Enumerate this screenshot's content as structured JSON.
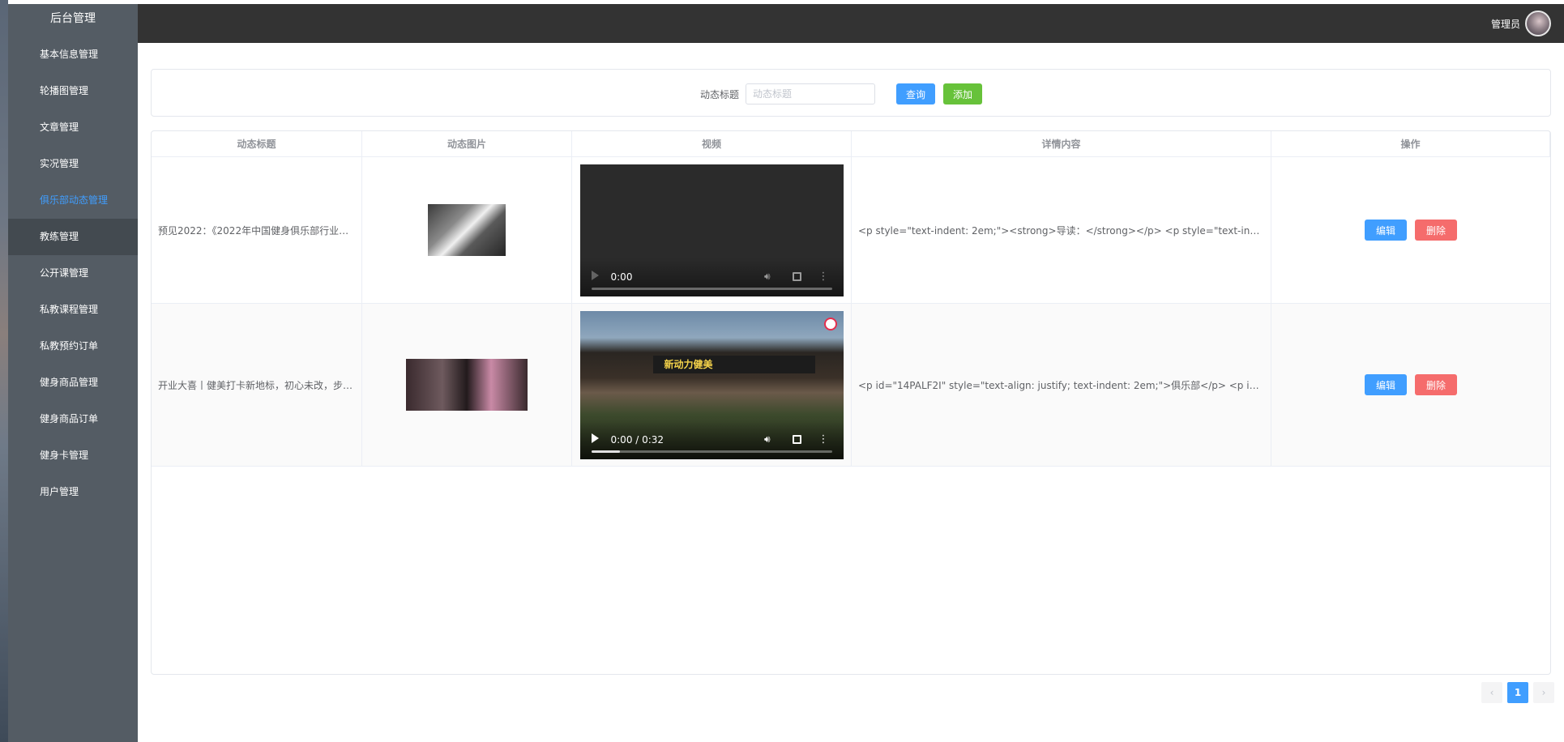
{
  "sidebar": {
    "title": "后台管理",
    "items": [
      {
        "label": "基本信息管理"
      },
      {
        "label": "轮播图管理"
      },
      {
        "label": "文章管理"
      },
      {
        "label": "实况管理"
      },
      {
        "label": "俱乐部动态管理"
      },
      {
        "label": "教练管理"
      },
      {
        "label": "公开课管理"
      },
      {
        "label": "私教课程管理"
      },
      {
        "label": "私教预约订单"
      },
      {
        "label": "健身商品管理"
      },
      {
        "label": "健身商品订单"
      },
      {
        "label": "健身卡管理"
      },
      {
        "label": "用户管理"
      }
    ],
    "active_index": 4
  },
  "header": {
    "user_label": "管理员",
    "avatar_icon": "user-avatar"
  },
  "search": {
    "label": "动态标题",
    "placeholder": "动态标题",
    "value": "",
    "query_label": "查询",
    "add_label": "添加"
  },
  "table": {
    "columns": [
      "动态标题",
      "动态图片",
      "视频",
      "详情内容",
      "操作"
    ],
    "rows": [
      {
        "title": "预见2022：《2022年中国健身俱乐部行业全...",
        "image_icon": "gym-treadmill-photo",
        "video": {
          "time": "0:00",
          "has_poster": false
        },
        "content": "<p style=\"text-indent: 2em;\"><strong>导读：</strong></p> <p style=\"text-indent: 2em;\"...",
        "edit_label": "编辑",
        "delete_label": "删除"
      },
      {
        "title": "开业大喜丨健美打卡新地标，初心未改，步履...",
        "image_icon": "dumbbell-rack-photo",
        "video": {
          "time": "0:00 / 0:32",
          "has_poster": true,
          "poster_sign": "新动力健美"
        },
        "content": "<p id=\"14PALF2I\" style=\"text-align: justify; text-indent: 2em;\">俱乐部</p> <p id=\"14PALF...",
        "edit_label": "编辑",
        "delete_label": "删除"
      }
    ]
  },
  "pagination": {
    "prev": "‹",
    "current": "1",
    "next": "›"
  },
  "colors": {
    "primary": "#409eff",
    "success": "#67c23a",
    "danger": "#f56c6c",
    "sidebar": "#545c64",
    "topbar": "#333333"
  }
}
